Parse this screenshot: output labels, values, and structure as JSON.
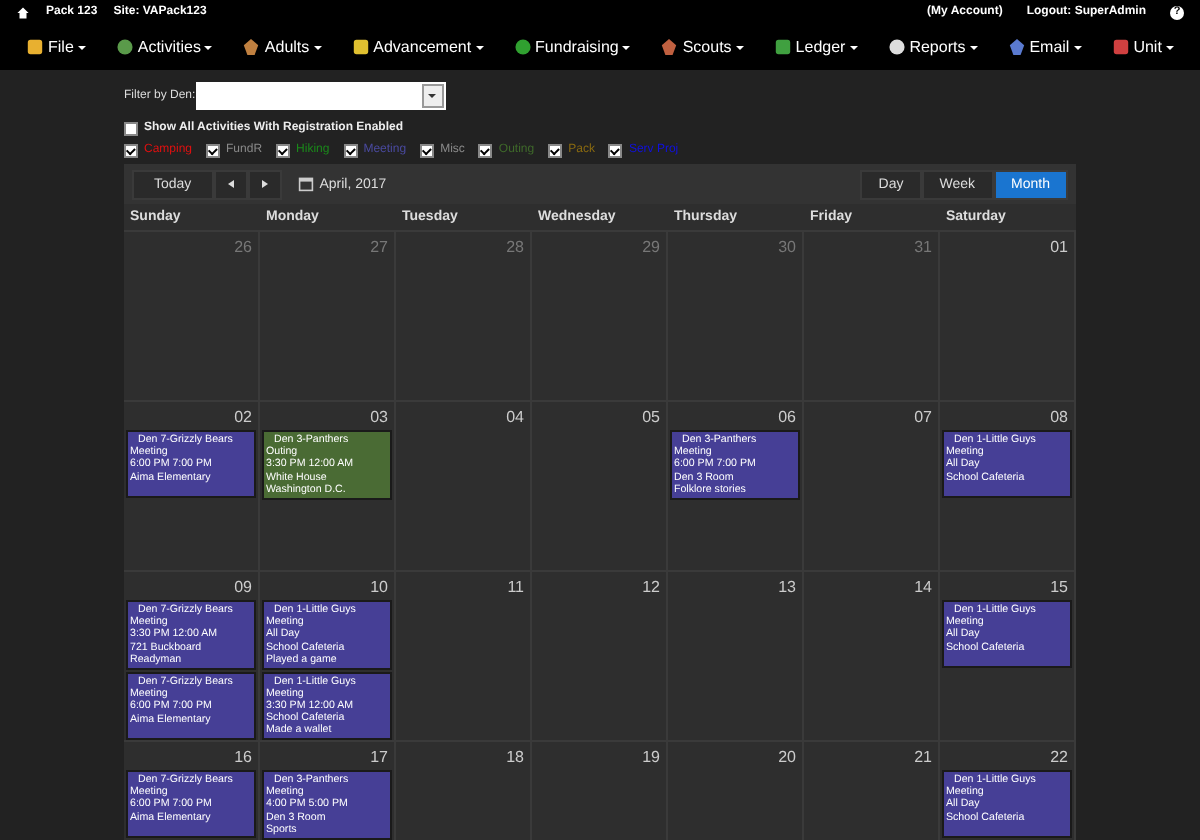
{
  "top_bar": {
    "pack": "Pack 123",
    "site": "Site: VAPack123",
    "account": "(My Account)",
    "logout": "Logout: SuperAdmin",
    "help": "?"
  },
  "menu": [
    {
      "label": "File"
    },
    {
      "label": "Activities"
    },
    {
      "label": "Adults"
    },
    {
      "label": "Advancement"
    },
    {
      "label": "Fundraising"
    },
    {
      "label": "Scouts"
    },
    {
      "label": "Ledger"
    },
    {
      "label": "Reports"
    },
    {
      "label": "Email"
    },
    {
      "label": "Unit"
    }
  ],
  "filter": {
    "label": "Filter by Den:"
  },
  "show_all": {
    "label": "Show All Activities With Registration Enabled",
    "checked": false
  },
  "categories": [
    {
      "label": "Camping",
      "checked": true,
      "color": "#e01010"
    },
    {
      "label": "FundR",
      "checked": true,
      "color": "#8a8a8a"
    },
    {
      "label": "Hiking",
      "checked": true,
      "color": "#1a8a1a"
    },
    {
      "label": "Meeting",
      "checked": true,
      "color": "#4a4aa0"
    },
    {
      "label": "Misc",
      "checked": true,
      "color": "#8a8a8a"
    },
    {
      "label": "Outing",
      "checked": true,
      "color": "#3f6a2a"
    },
    {
      "label": "Pack",
      "checked": true,
      "color": "#8a6a10"
    },
    {
      "label": "Serv Proj",
      "checked": true,
      "color": "#1010e0"
    }
  ],
  "toolbar": {
    "today": "Today",
    "month_label": "April, 2017",
    "views": [
      {
        "label": "Day",
        "selected": false
      },
      {
        "label": "Week",
        "selected": false
      },
      {
        "label": "Month",
        "selected": true
      }
    ]
  },
  "weekdays": [
    "Sunday",
    "Monday",
    "Tuesday",
    "Wednesday",
    "Thursday",
    "Friday",
    "Saturday"
  ],
  "weeks": [
    {
      "days": [
        {
          "date": "26",
          "muted": true
        },
        {
          "date": "27",
          "muted": true
        },
        {
          "date": "28",
          "muted": true
        },
        {
          "date": "29",
          "muted": true
        },
        {
          "date": "30",
          "muted": true
        },
        {
          "date": "31",
          "muted": true
        },
        {
          "date": "01",
          "muted": false
        }
      ]
    },
    {
      "days": [
        {
          "date": "02",
          "muted": false,
          "events": [
            {
              "title": "Den 7-Grizzly Bears",
              "color": "#463f96",
              "lines": [
                "Meeting",
                "6:00 PM 7:00 PM",
                "Aima Elementary"
              ]
            }
          ]
        },
        {
          "date": "03",
          "muted": false,
          "events": [
            {
              "title": "Den 3-Panthers",
              "color": "#4a6b34",
              "lines": [
                "Outing",
                "3:30 PM 12:00 AM",
                "White House",
                "Washington D.C."
              ]
            }
          ]
        },
        {
          "date": "04",
          "muted": false
        },
        {
          "date": "05",
          "muted": false
        },
        {
          "date": "06",
          "muted": false,
          "events": [
            {
              "title": "Den 3-Panthers",
              "color": "#463f96",
              "lines": [
                "Meeting",
                "6:00 PM 7:00 PM",
                "Den 3 Room",
                "Folklore stories"
              ]
            }
          ]
        },
        {
          "date": "07",
          "muted": false
        },
        {
          "date": "08",
          "muted": false,
          "events": [
            {
              "title": "Den 1-Little Guys",
              "color": "#463f96",
              "lines": [
                "Meeting",
                "All Day",
                "School Cafeteria"
              ]
            }
          ]
        }
      ]
    },
    {
      "days": [
        {
          "date": "09",
          "muted": false,
          "events": [
            {
              "title": "Den 7-Grizzly Bears",
              "color": "#463f96",
              "lines": [
                "Meeting",
                "3:30 PM 12:00 AM",
                "721 Buckboard",
                "Readyman"
              ]
            },
            {
              "title": "Den 7-Grizzly Bears",
              "color": "#463f96",
              "lines": [
                "Meeting",
                "6:00 PM 7:00 PM",
                "Aima Elementary"
              ]
            }
          ]
        },
        {
          "date": "10",
          "muted": false,
          "events": [
            {
              "title": "Den 1-Little Guys",
              "color": "#463f96",
              "lines": [
                "Meeting",
                "All Day",
                "School Cafeteria",
                "Played a game"
              ]
            },
            {
              "title": "Den 1-Little Guys",
              "color": "#463f96",
              "lines": [
                "Meeting",
                "3:30 PM 12:00 AM",
                "School Cafeteria",
                "Made a wallet"
              ]
            }
          ]
        },
        {
          "date": "11",
          "muted": false
        },
        {
          "date": "12",
          "muted": false
        },
        {
          "date": "13",
          "muted": false
        },
        {
          "date": "14",
          "muted": false
        },
        {
          "date": "15",
          "muted": false,
          "events": [
            {
              "title": "Den 1-Little Guys",
              "color": "#463f96",
              "lines": [
                "Meeting",
                "All Day",
                "School Cafeteria"
              ]
            }
          ]
        }
      ]
    },
    {
      "days": [
        {
          "date": "16",
          "muted": false,
          "events": [
            {
              "title": "Den 7-Grizzly Bears",
              "color": "#463f96",
              "lines": [
                "Meeting",
                "6:00 PM 7:00 PM",
                "Aima Elementary"
              ]
            }
          ]
        },
        {
          "date": "17",
          "muted": false,
          "events": [
            {
              "title": "Den 3-Panthers",
              "color": "#463f96",
              "lines": [
                "Meeting",
                "4:00 PM 5:00 PM",
                "Den 3 Room",
                "Sports"
              ]
            }
          ]
        },
        {
          "date": "18",
          "muted": false
        },
        {
          "date": "19",
          "muted": false
        },
        {
          "date": "20",
          "muted": false
        },
        {
          "date": "21",
          "muted": false
        },
        {
          "date": "22",
          "muted": false,
          "events": [
            {
              "title": "Den 1-Little Guys",
              "color": "#463f96",
              "lines": [
                "Meeting",
                "All Day",
                "School Cafeteria"
              ]
            }
          ]
        }
      ]
    }
  ]
}
